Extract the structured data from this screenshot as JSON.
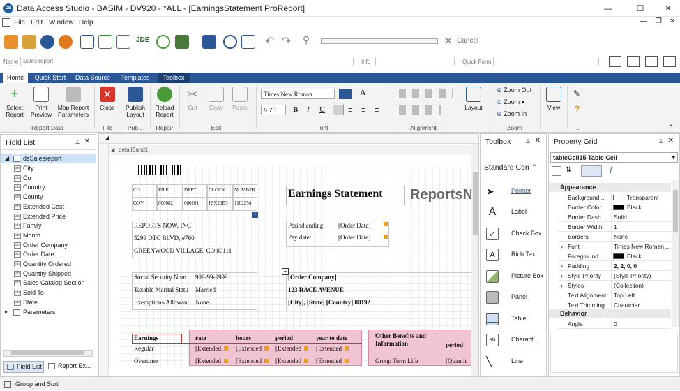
{
  "window": {
    "title": "Data Access Studio - BASIM - DV920 - *ALL - [EarningsStatement ProReport]",
    "icon": "DB",
    "min": "—",
    "max": "☐",
    "close": "✕"
  },
  "menu": [
    "File",
    "Edit",
    "Window",
    "Help"
  ],
  "quickbar": {
    "jde": "JDE",
    "cancel_label": "Cancel"
  },
  "namebar": {
    "name_label": "Name",
    "name_value": "Sales report",
    "info_label": "Info",
    "info_value": "",
    "quickform_label": "Quick Form",
    "quickform_value": ""
  },
  "tabs": [
    "Home",
    "Quick Start",
    "Data Source",
    "Templates",
    "Toolbox"
  ],
  "ribbon": {
    "buttons": [
      {
        "label": "Select\nReport"
      },
      {
        "label": "Print\nPreview"
      },
      {
        "label": "Map Report\nParameters"
      },
      {
        "label": "Close"
      },
      {
        "label": "Publish\nLayout"
      },
      {
        "label": "Reload\nReport"
      },
      {
        "label": "Cut"
      },
      {
        "label": "Copy"
      },
      {
        "label": "Paste"
      }
    ],
    "font_name": "Times New Roman",
    "font_size": "9.75",
    "zoom_out": "Zoom Out",
    "zoom": "Zoom",
    "zoom_in": "Zoom In",
    "layout": "Layout",
    "view": "View",
    "groups": {
      "report_data": "Report Data",
      "file": "File",
      "pub": "Pub...",
      "repair": "Repair",
      "edit": "Edit",
      "font": "Font",
      "alignment": "Alignment",
      "zoom": "Zoom",
      "more": "..."
    }
  },
  "field_list": {
    "title": "Field List",
    "root": "dsSalesreport",
    "fields": [
      "City",
      "Co",
      "Country",
      "County",
      "Extended Cost",
      "Extended Price",
      "Family",
      "Month",
      "Order Company",
      "Order Date",
      "Quantity Ordered",
      "Quantity Shipped",
      "Sales Catalog Section",
      "Sold To",
      "State"
    ],
    "parameters": "Parameters",
    "bottom_tabs": [
      "Field List",
      "Report Ex..."
    ]
  },
  "canvas": {
    "band": "detailBand1",
    "header_cols": [
      "CO",
      "FILE",
      "DEPT.",
      "CLOCK",
      "NUMBER"
    ],
    "header_vals": [
      "QOV",
      "000082",
      "000201",
      "JBX20B3",
      "1102254"
    ],
    "title": "Earnings Statement",
    "logo": "ReportsN",
    "company": [
      "REPORTS NOW, INC",
      "5299 DTC BLVD, #760",
      "GREENWOOD VILLAGE, CO 80111"
    ],
    "period_label": "Period ending:",
    "period_val": "[Order Date]",
    "pay_label": "Pay date:",
    "pay_val": "[Order Date]",
    "ss_label": "Social Security Num",
    "ss_val": "999-99-9999",
    "tax_label": "Taxable Marital Statu",
    "tax_val": "Married",
    "ex_label": "Exemptions/Allowan",
    "ex_val": "None",
    "addr": [
      "[Order Company]",
      "123 RACE AVENUE",
      "[City], [State] [Country] 80192"
    ],
    "earn_hdr": [
      "Earnings",
      "rate",
      "hours",
      "period",
      "year to date"
    ],
    "earn_rows": [
      "Regular",
      "Overtime"
    ],
    "extended": "[Extended",
    "other": "Other Benefits and Information",
    "period": "period",
    "gtl": "Group Term Life",
    "quantity": "[Quantit"
  },
  "toolbox": {
    "title": "Toolbox",
    "section": "Standard Con",
    "items": [
      "Pointer",
      "Label",
      "Check Box",
      "Rich Text",
      "Picture Box",
      "Panel",
      "Table",
      "Charact...",
      "Line"
    ]
  },
  "property_grid": {
    "title": "Property Grid",
    "selector": "tableCell15  Table Cell",
    "cat_appearance": "Appearance",
    "rows": [
      {
        "k": "Background ...",
        "v": "Transparent"
      },
      {
        "k": "Border Color",
        "v": "Black"
      },
      {
        "k": "Border Dash ...",
        "v": "Solid"
      },
      {
        "k": "Border Width",
        "v": "1"
      },
      {
        "k": "Borders",
        "v": "None"
      },
      {
        "k": "Font",
        "v": "Times New Roman,..."
      },
      {
        "k": "Foreground ...",
        "v": "Black"
      },
      {
        "k": "Padding",
        "v": "2, 2, 0, 0"
      },
      {
        "k": "Style Priority",
        "v": "(Style Priority)"
      },
      {
        "k": "Styles",
        "v": "(Collection)"
      },
      {
        "k": "Text Alignment",
        "v": "Top Left"
      },
      {
        "k": "Text Trimming",
        "v": "Character"
      }
    ],
    "cat_behavior": "Behavior",
    "angle_k": "Angle",
    "angle_v": "0"
  },
  "status": "Group and Sort",
  "colors": {
    "accent": "#2b5797",
    "pink": "#f1c4d1",
    "logo_orange": "#f47b20"
  }
}
